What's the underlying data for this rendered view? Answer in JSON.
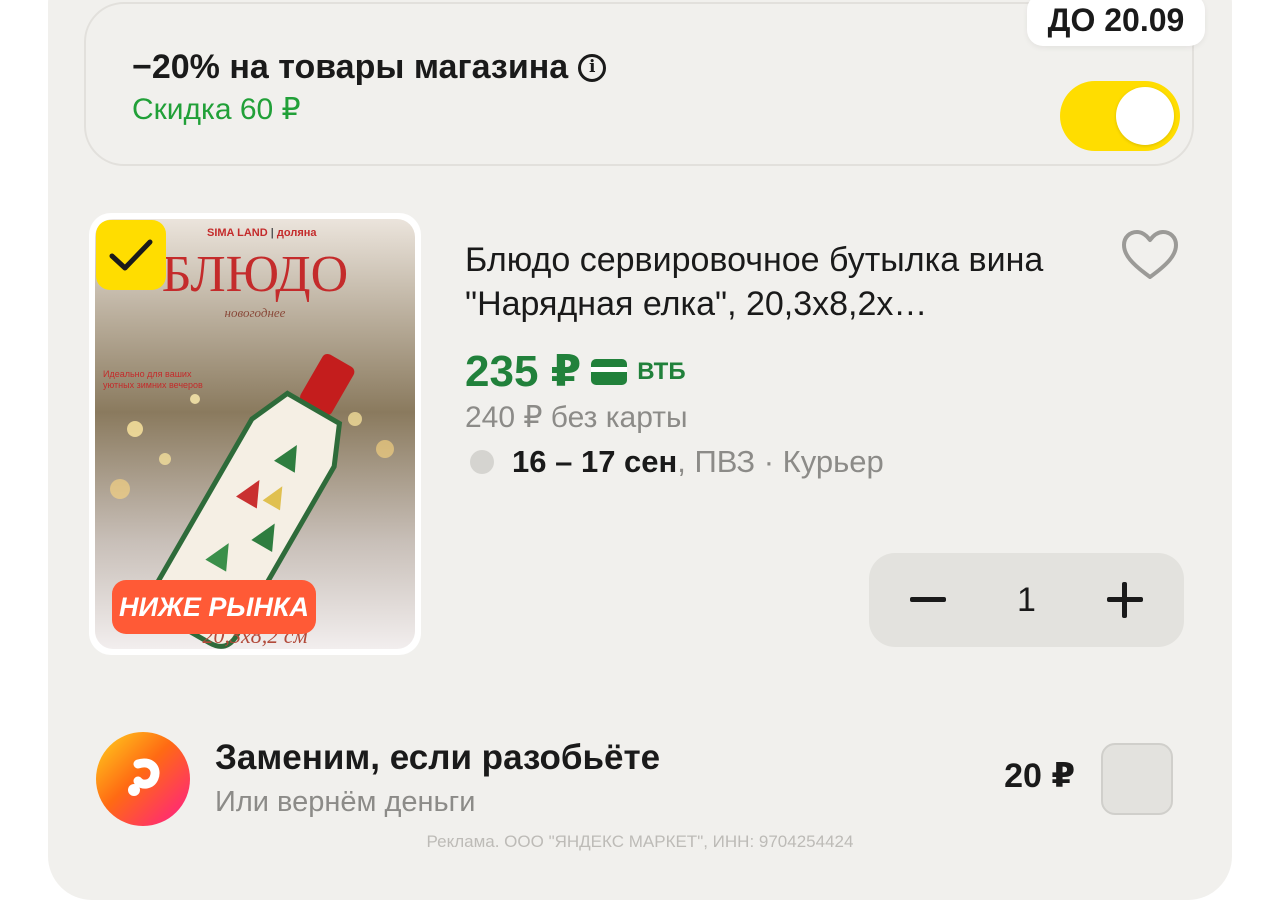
{
  "promo": {
    "title": "−20% на товары магазина",
    "discount": "Скидка 60 ₽",
    "deadline": "ДО 20.09",
    "toggle_on": true
  },
  "product": {
    "title": "Блюдо сервировочное бутылка вина \"Нарядная елка\", 20,3х8,2х…",
    "price": "235 ₽",
    "bank": "ВТБ",
    "price_no_card": "240 ₽  без карты",
    "delivery_date": "16 – 17 сен",
    "delivery_methods": ", ПВЗ · Курьер",
    "quantity": "1",
    "selected": true,
    "image": {
      "brand_primary": "SIMA LAND",
      "brand_secondary": "доляна",
      "headline": "БЛЮДО",
      "subline": "новогоднее",
      "tagline": "Идеально для ваших уютных зимних вечеров",
      "size_caption": "20,3x8,2 см",
      "badge": "НИЖЕ РЫНКА"
    }
  },
  "insurance": {
    "title": "Заменим, если разобьёте",
    "subtitle": "Или вернём деньги",
    "price": "20 ₽",
    "checked": false
  },
  "ad_notice": "Реклама. ООО \"ЯНДЕКС МАРКЕТ\", ИНН: 9704254424",
  "colors": {
    "accent_yellow": "#ffdd00",
    "discount_green": "#21a038",
    "price_green": "#21813b",
    "badge_red": "#ff5a36",
    "panel_bg": "#f1f0ed"
  }
}
